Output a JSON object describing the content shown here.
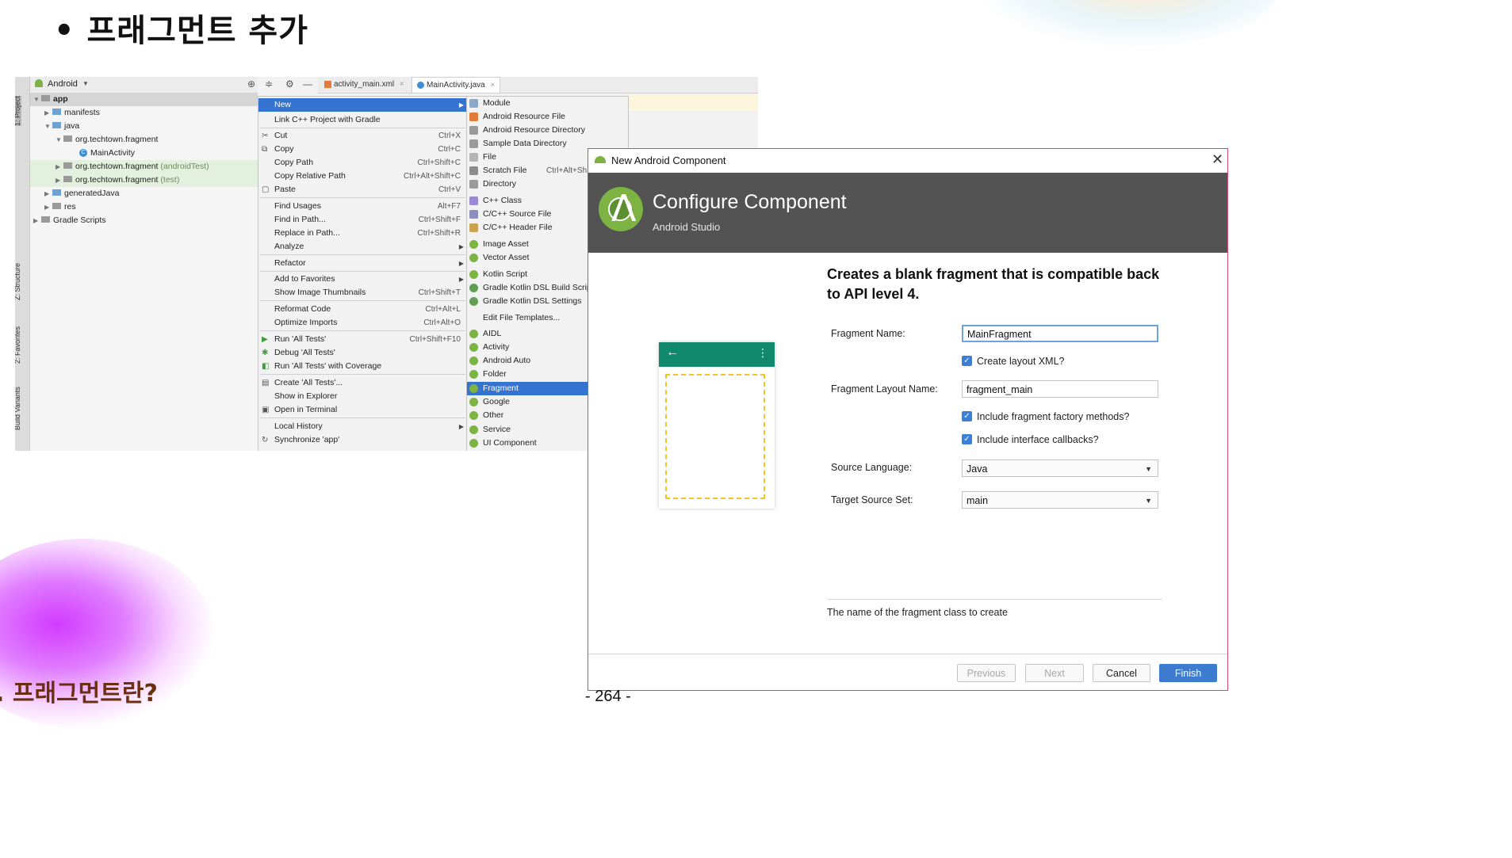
{
  "slide": {
    "title": "• 프래그먼트 추가",
    "footer_heading": ". 프래그먼트란?",
    "page_number": "- 264 -"
  },
  "ide": {
    "side_tabs": [
      "1: Project",
      "Z: Structure",
      "2: Favorites",
      "Build Variants"
    ],
    "project_view_label": "Android",
    "editor_tabs": [
      {
        "label": "activity_main.xml",
        "selected": false
      },
      {
        "label": "MainActivity.java",
        "selected": true
      }
    ],
    "tree": [
      {
        "label": "app"
      },
      {
        "label": "manifests"
      },
      {
        "label": "java"
      },
      {
        "label": "org.techtown.fragment"
      },
      {
        "label": "MainActivity"
      },
      {
        "label": "org.techtown.fragment",
        "suffix": "(androidTest)"
      },
      {
        "label": "org.techtown.fragment",
        "suffix": "(test)"
      },
      {
        "label": "generatedJava"
      },
      {
        "label": "res"
      },
      {
        "label": "Gradle Scripts"
      }
    ],
    "context_menu": [
      {
        "label": "New",
        "shortcut": ""
      },
      {
        "label": "Link C++ Project with Gradle",
        "shortcut": ""
      },
      {
        "label": "Cut",
        "shortcut": "Ctrl+X"
      },
      {
        "label": "Copy",
        "shortcut": "Ctrl+C"
      },
      {
        "label": "Copy Path",
        "shortcut": "Ctrl+Shift+C"
      },
      {
        "label": "Copy Relative Path",
        "shortcut": "Ctrl+Alt+Shift+C"
      },
      {
        "label": "Paste",
        "shortcut": "Ctrl+V"
      },
      {
        "label": "Find Usages",
        "shortcut": "Alt+F7"
      },
      {
        "label": "Find in Path...",
        "shortcut": "Ctrl+Shift+F"
      },
      {
        "label": "Replace in Path...",
        "shortcut": "Ctrl+Shift+R"
      },
      {
        "label": "Analyze",
        "shortcut": ""
      },
      {
        "label": "Refactor",
        "shortcut": ""
      },
      {
        "label": "Add to Favorites",
        "shortcut": ""
      },
      {
        "label": "Show Image Thumbnails",
        "shortcut": "Ctrl+Shift+T"
      },
      {
        "label": "Reformat Code",
        "shortcut": "Ctrl+Alt+L"
      },
      {
        "label": "Optimize Imports",
        "shortcut": "Ctrl+Alt+O"
      },
      {
        "label": "Run 'All Tests'",
        "shortcut": "Ctrl+Shift+F10"
      },
      {
        "label": "Debug 'All Tests'",
        "shortcut": ""
      },
      {
        "label": "Run 'All Tests' with Coverage",
        "shortcut": ""
      },
      {
        "label": "Create 'All Tests'...",
        "shortcut": ""
      },
      {
        "label": "Show in Explorer",
        "shortcut": ""
      },
      {
        "label": "Open in Terminal",
        "shortcut": ""
      },
      {
        "label": "Local History",
        "shortcut": ""
      },
      {
        "label": "Synchronize 'app'",
        "shortcut": ""
      }
    ],
    "new_submenu": [
      {
        "label": "Module",
        "shortcut": ""
      },
      {
        "label": "Android Resource File",
        "shortcut": ""
      },
      {
        "label": "Android Resource Directory",
        "shortcut": ""
      },
      {
        "label": "Sample Data Directory",
        "shortcut": ""
      },
      {
        "label": "File",
        "shortcut": ""
      },
      {
        "label": "Scratch File",
        "shortcut": "Ctrl+Alt+Sh"
      },
      {
        "label": "Directory",
        "shortcut": ""
      },
      {
        "label": "C++ Class",
        "shortcut": ""
      },
      {
        "label": "C/C++ Source File",
        "shortcut": ""
      },
      {
        "label": "C/C++ Header File",
        "shortcut": ""
      },
      {
        "label": "Image Asset",
        "shortcut": ""
      },
      {
        "label": "Vector Asset",
        "shortcut": ""
      },
      {
        "label": "Kotlin Script",
        "shortcut": ""
      },
      {
        "label": "Gradle Kotlin DSL Build Script",
        "shortcut": ""
      },
      {
        "label": "Gradle Kotlin DSL Settings",
        "shortcut": ""
      },
      {
        "label": "Edit File Templates...",
        "shortcut": ""
      },
      {
        "label": "AIDL",
        "shortcut": ""
      },
      {
        "label": "Activity",
        "shortcut": ""
      },
      {
        "label": "Android Auto",
        "shortcut": ""
      },
      {
        "label": "Folder",
        "shortcut": ""
      },
      {
        "label": "Fragment",
        "shortcut": ""
      },
      {
        "label": "Google",
        "shortcut": ""
      },
      {
        "label": "Other",
        "shortcut": ""
      },
      {
        "label": "Service",
        "shortcut": ""
      },
      {
        "label": "UI Component",
        "shortcut": ""
      }
    ]
  },
  "dialog": {
    "window_title": "New Android Component",
    "header_title": "Configure Component",
    "header_subtitle": "Android Studio",
    "description": "Creates a blank fragment that is compatible back to API level 4.",
    "fields": {
      "fragment_name_label": "Fragment Name:",
      "fragment_name_value": "MainFragment",
      "create_layout_label": "Create layout XML?",
      "create_layout_checked": true,
      "layout_name_label": "Fragment Layout Name:",
      "layout_name_value": "fragment_main",
      "factory_methods_label": "Include fragment factory methods?",
      "factory_methods_checked": true,
      "interface_callbacks_label": "Include interface callbacks?",
      "interface_callbacks_checked": true,
      "source_language_label": "Source Language:",
      "source_language_value": "Java",
      "target_source_set_label": "Target Source Set:",
      "target_source_set_value": "main"
    },
    "hint": "The name of the fragment class to create",
    "buttons": {
      "previous": "Previous",
      "next": "Next",
      "cancel": "Cancel",
      "finish": "Finish"
    }
  },
  "colors": {
    "dialog_border": "#d5477a",
    "header_bg": "#535353",
    "menu_highlight": "#3573d0",
    "finish_button": "#3d7bd0",
    "preview_bar": "#10896d"
  }
}
